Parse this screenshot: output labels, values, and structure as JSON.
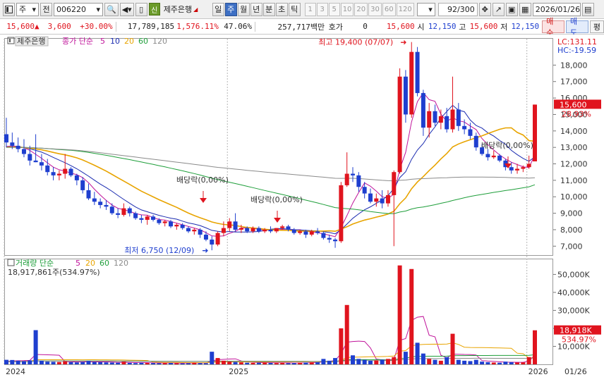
{
  "toolbar": {
    "market": "주",
    "mode": "전",
    "code": "006220",
    "badge": "신",
    "stock_name": "제주은행",
    "periods": [
      "일",
      "주",
      "월",
      "년",
      "분",
      "초",
      "틱"
    ],
    "active_period": "주",
    "intervals": [
      "1",
      "3",
      "5",
      "10",
      "20",
      "30",
      "60",
      "120"
    ],
    "count": "92",
    "count_total": "/300",
    "date": "2026/01/26"
  },
  "quote": {
    "price": "15,600",
    "change": "3,600",
    "change_pct": "+30.00%",
    "volume": "17,789,185",
    "volume_ratio": "1,576.11%",
    "turnover": "47.06%",
    "amount": "257,717백만",
    "hoga_label": "호가",
    "hoga_value": "0",
    "current": "15,600",
    "open_label": "시",
    "open": "12,150",
    "high_label": "고",
    "high": "15,600",
    "low_label": "저",
    "low": "12,150",
    "buy_label": "매수",
    "sell_label": "매도",
    "eval_label": "평"
  },
  "price_panel": {
    "stock_label": "제주은행",
    "legend_title": "종가 단순",
    "ma_periods": [
      "5",
      "10",
      "20",
      "60",
      "120"
    ],
    "lc": "LC:131.11",
    "hc": "HC:-19.59",
    "yaxis_ticks": [
      "18,000",
      "17,000",
      "16,000",
      "15,000",
      "14,000",
      "13,000",
      "12,000",
      "11,000",
      "10,000",
      "9,000",
      "8,000",
      "7,000"
    ],
    "current_tag": "15,600",
    "current_pct": "28.93%",
    "max_label": "최고 19,400 (07/07)",
    "min_label": "최저 6,750 (12/09)",
    "dividend_labels": [
      "배당락(0,00%)",
      "배당락(0,00%)",
      "배당락(0,00%)"
    ]
  },
  "volume_panel": {
    "legend_title": "거래량 단순",
    "ma_periods": [
      "5",
      "20",
      "60",
      "120"
    ],
    "current_label": "18,917,861주(534.97%)",
    "yaxis_ticks": [
      "50,000K",
      "40,000K",
      "30,000K",
      "20,000K",
      "10,000K"
    ],
    "current_tag": "18,918K",
    "current_pct": "534.97%"
  },
  "xaxis": {
    "labels": [
      "2024",
      "2025",
      "2026"
    ],
    "right_label": "01/26"
  },
  "colors": {
    "up": "#e0141e",
    "down": "#1f3fcf",
    "ma5": "#c0139a",
    "ma10": "#1a2bb0",
    "ma20": "#e8a400",
    "ma60": "#1e9e3a",
    "ma120": "#8a8a8a"
  },
  "chart_data": {
    "type": "candlestick",
    "interval": "weekly",
    "candles": [
      [
        13800,
        14800,
        13000,
        13300
      ],
      [
        13300,
        13900,
        12900,
        13100
      ],
      [
        13100,
        13600,
        12700,
        12900
      ],
      [
        12900,
        13500,
        12400,
        12600
      ],
      [
        12600,
        13100,
        11900,
        12200
      ],
      [
        12200,
        13800,
        12100,
        12100
      ],
      [
        12100,
        12600,
        11600,
        11900
      ],
      [
        11900,
        12300,
        11300,
        11500
      ],
      [
        11500,
        11800,
        11000,
        11300
      ],
      [
        11300,
        11600,
        11000,
        11400
      ],
      [
        11400,
        12600,
        11100,
        11700
      ],
      [
        11700,
        11800,
        11200,
        11300
      ],
      [
        11300,
        11400,
        10700,
        11000
      ],
      [
        11000,
        11200,
        10200,
        10400
      ],
      [
        10400,
        10800,
        9800,
        9900
      ],
      [
        9900,
        10300,
        9500,
        9700
      ],
      [
        9700,
        9900,
        9300,
        9500
      ],
      [
        9500,
        9800,
        9200,
        9400
      ],
      [
        9400,
        9600,
        8900,
        9000
      ],
      [
        9000,
        9300,
        8700,
        8900
      ],
      [
        8900,
        9600,
        8800,
        9300
      ],
      [
        9300,
        9400,
        8800,
        9000
      ],
      [
        9000,
        9100,
        8600,
        8700
      ],
      [
        8700,
        8900,
        8400,
        8600
      ],
      [
        8600,
        8900,
        8300,
        8800
      ],
      [
        8800,
        8900,
        8500,
        8600
      ],
      [
        8600,
        8700,
        8300,
        8400
      ],
      [
        8400,
        8600,
        8200,
        8500
      ],
      [
        8500,
        8600,
        8100,
        8200
      ],
      [
        8200,
        8400,
        8000,
        8300
      ],
      [
        8300,
        8400,
        8000,
        8100
      ],
      [
        8100,
        8200,
        7800,
        7900
      ],
      [
        7900,
        8100,
        7700,
        8000
      ],
      [
        8000,
        8100,
        7500,
        7700
      ],
      [
        7700,
        7900,
        7300,
        7400
      ],
      [
        7400,
        7600,
        6750,
        7100
      ],
      [
        7100,
        7900,
        7000,
        7800
      ],
      [
        7800,
        8500,
        7600,
        8100
      ],
      [
        8100,
        8700,
        7900,
        8500
      ],
      [
        8500,
        9000,
        7900,
        8000
      ],
      [
        8000,
        8300,
        7800,
        8100
      ],
      [
        8100,
        8200,
        7800,
        7900
      ],
      [
        7900,
        8200,
        7800,
        8100
      ],
      [
        8100,
        8200,
        7800,
        7900
      ],
      [
        7900,
        8100,
        7800,
        8000
      ],
      [
        8000,
        8200,
        7800,
        7900
      ],
      [
        7900,
        8100,
        7800,
        8100
      ],
      [
        8100,
        8300,
        8000,
        8200
      ],
      [
        8200,
        8300,
        7900,
        8000
      ],
      [
        8000,
        8100,
        7700,
        7800
      ],
      [
        7800,
        8000,
        7700,
        7900
      ],
      [
        7900,
        8000,
        7500,
        7700
      ],
      [
        7700,
        8000,
        7600,
        7900
      ],
      [
        7900,
        8100,
        7700,
        7800
      ],
      [
        7800,
        7900,
        7400,
        7500
      ],
      [
        7500,
        7700,
        7200,
        7400
      ],
      [
        7400,
        7500,
        6900,
        7300
      ],
      [
        7300,
        10900,
        7200,
        10700
      ],
      [
        10700,
        12700,
        10600,
        11400
      ],
      [
        11400,
        11800,
        10900,
        11300
      ],
      [
        11300,
        11500,
        10300,
        10600
      ],
      [
        10600,
        10900,
        9900,
        10200
      ],
      [
        10200,
        10500,
        9600,
        9700
      ],
      [
        9700,
        10200,
        9400,
        9900
      ],
      [
        9900,
        10400,
        9300,
        9600
      ],
      [
        9600,
        10400,
        9400,
        10100
      ],
      [
        10100,
        11600,
        7000,
        11500
      ],
      [
        11500,
        17800,
        11400,
        17300
      ],
      [
        17300,
        17700,
        14500,
        15000
      ],
      [
        15000,
        19400,
        14800,
        18800
      ],
      [
        18800,
        19100,
        16100,
        16300
      ],
      [
        16300,
        16500,
        13700,
        14200
      ],
      [
        14200,
        15700,
        13600,
        15200
      ],
      [
        15200,
        15600,
        14300,
        14500
      ],
      [
        14500,
        15300,
        14100,
        14900
      ],
      [
        14900,
        15400,
        13900,
        14100
      ],
      [
        14100,
        17300,
        13900,
        15300
      ],
      [
        15300,
        15700,
        14000,
        14300
      ],
      [
        14300,
        14700,
        13800,
        14100
      ],
      [
        14100,
        14500,
        13500,
        13700
      ],
      [
        13700,
        13900,
        12800,
        13000
      ],
      [
        13000,
        13200,
        12500,
        12600
      ],
      [
        12600,
        12900,
        12200,
        12400
      ],
      [
        12400,
        12800,
        12300,
        12500
      ],
      [
        12500,
        12600,
        12100,
        12200
      ],
      [
        12200,
        12300,
        11600,
        11800
      ],
      [
        11800,
        12100,
        11400,
        11600
      ],
      [
        11600,
        12000,
        11400,
        11700
      ],
      [
        11700,
        11900,
        11500,
        11800
      ],
      [
        11800,
        12500,
        11700,
        12000
      ],
      [
        12150,
        15600,
        12150,
        15600
      ]
    ],
    "volume_k": [
      2500,
      2400,
      2000,
      1800,
      2200,
      19000,
      2000,
      1500,
      1400,
      1300,
      1700,
      1200,
      1100,
      1300,
      1900,
      1300,
      1200,
      1100,
      1000,
      900,
      1500,
      800,
      700,
      900,
      800,
      700,
      600,
      700,
      800,
      600,
      500,
      600,
      900,
      700,
      600,
      7000,
      3500,
      2000,
      1500,
      1300,
      1100,
      900,
      800,
      900,
      1000,
      800,
      700,
      800,
      600,
      700,
      900,
      1000,
      1100,
      1200,
      3000,
      2000,
      3500,
      20000,
      33000,
      5000,
      3000,
      2500,
      2000,
      2200,
      2600,
      3000,
      4000,
      55000,
      7000,
      53000,
      12000,
      6000,
      3000,
      2500,
      2000,
      4000,
      17000,
      2500,
      2000,
      1800,
      2500,
      1500,
      1200,
      1000,
      900,
      1500,
      1200,
      1000,
      1100,
      4000,
      18918
    ],
    "ylim": [
      6500,
      19600
    ],
    "volume_ylim": [
      0,
      58000
    ],
    "x_year_marks": [
      {
        "label": "2024",
        "index": 0
      },
      {
        "label": "2025",
        "index": 38
      },
      {
        "label": "2026",
        "index": 89
      }
    ],
    "annotations": {
      "max": {
        "label": "최고 19,400 (07/07)",
        "index": 69,
        "price": 19400
      },
      "min": {
        "label": "최저 6,750 (12/09)",
        "index": 35,
        "price": 6750
      },
      "dividends": [
        {
          "index": 35
        },
        {
          "index": 51
        },
        {
          "index": 89
        }
      ]
    }
  }
}
